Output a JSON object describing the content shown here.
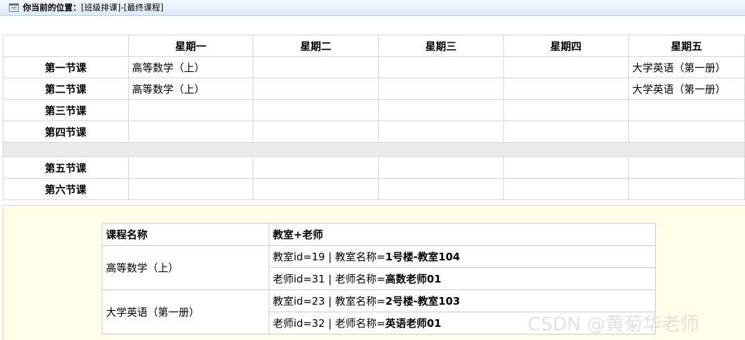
{
  "header": {
    "location_label": "你当前的位置：",
    "location_path": "[班级排课]-[最终课程]"
  },
  "schedule": {
    "days": [
      "星期一",
      "星期二",
      "星期三",
      "星期四",
      "星期五"
    ],
    "periods_morning": [
      {
        "label": "第一节课",
        "cells": [
          "高等数学（上）",
          "",
          "",
          "",
          "大学英语（第一册）"
        ]
      },
      {
        "label": "第二节课",
        "cells": [
          "高等数学（上）",
          "",
          "",
          "",
          "大学英语（第一册）"
        ]
      },
      {
        "label": "第三节课",
        "cells": [
          "",
          "",
          "",
          "",
          ""
        ]
      },
      {
        "label": "第四节课",
        "cells": [
          "",
          "",
          "",
          "",
          ""
        ]
      }
    ],
    "periods_afternoon": [
      {
        "label": "第五节课",
        "cells": [
          "",
          "",
          "",
          "",
          ""
        ]
      },
      {
        "label": "第六节课",
        "cells": [
          "",
          "",
          "",
          "",
          ""
        ]
      }
    ]
  },
  "detail": {
    "col_course": "课程名称",
    "col_room_teacher": "教室+老师",
    "courses": [
      {
        "name": "高等数学（上）",
        "room_prefix": "教室id=19 | 教室名称=",
        "room_name": "1号楼-教室104",
        "teacher_prefix": "老师id=31 | 老师名称=",
        "teacher_name": "高数老师01"
      },
      {
        "name": "大学英语（第一册）",
        "room_prefix": "教室id=23 | 教室名称=",
        "room_name": "2号楼-教室103",
        "teacher_prefix": "老师id=32 | 老师名称=",
        "teacher_name": "英语老师01"
      }
    ]
  },
  "watermark": "CSDN @黄菊华老师",
  "icons": {
    "breadcrumb": "list-icon"
  }
}
